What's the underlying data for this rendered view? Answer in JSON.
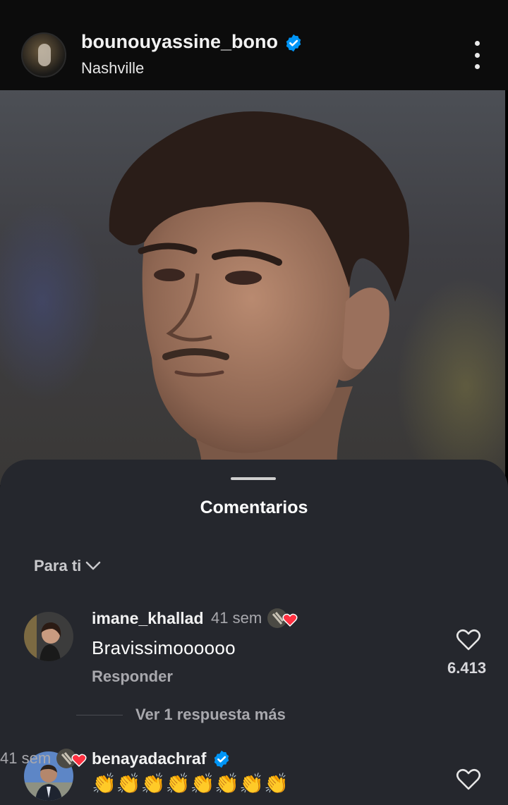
{
  "post": {
    "username": "bounouyassine_bono",
    "location": "Nashville"
  },
  "icons": {
    "verified": "verified-badge-icon",
    "more": "more-vertical-icon",
    "like": "heart-outline-icon",
    "creator_like": "creator-liked-icon"
  },
  "colors": {
    "verified": "#0095f6",
    "sheet_bg": "#25272d",
    "creator_heart": "#ff3040"
  },
  "comments_sheet": {
    "title": "Comentarios",
    "sort_label": "Para ti"
  },
  "comments": [
    {
      "username": "imane_khallad",
      "time": "41 sem",
      "text": "Bravissimoooooo",
      "reply_label": "Responder",
      "like_count": "6.413",
      "view_replies": "Ver 1 respuesta más"
    },
    {
      "username": "benayadachraf",
      "time": "41 sem",
      "text": "👏👏👏👏👏👏👏👏"
    }
  ]
}
